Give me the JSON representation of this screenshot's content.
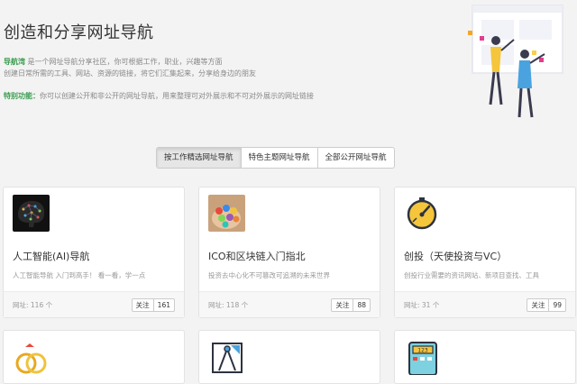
{
  "hero": {
    "title": "创造和分享网址导航",
    "brand": "导航湾",
    "intro_line1": "是一个网址导航分享社区，你可根据工作，职业，兴趣等方面",
    "intro_line2": "创建日常所需的工具、网站、资源的链接，将它们汇集起来，分享给身边的朋友",
    "feature_label": "特别功能：",
    "feature_text": "你可以创建公开和非公开的网址导航，用来整理可对外展示和不可对外展示的网址链接"
  },
  "tabs": [
    {
      "label": "按工作精选网址导航",
      "active": true
    },
    {
      "label": "特色主题网址导航",
      "active": false
    },
    {
      "label": "全部公开网址导航",
      "active": false
    }
  ],
  "cards": [
    {
      "title": "人工智能(AI)导航",
      "desc": "人工智能导航 入门到高手！ 看一看，学一点",
      "count": "网址: 116 个",
      "follow_label": "关注",
      "follow_count": "161"
    },
    {
      "title": "ICO和区块链入门指北",
      "desc": "投资去中心化不可篡改可追溯的未来世界",
      "count": "网址: 118 个",
      "follow_label": "关注",
      "follow_count": "88"
    },
    {
      "title": "创投（天使投资与VC）",
      "desc": "创投行业需要的资讯网站、新项目查找、工具",
      "count": "网址: 31 个",
      "follow_label": "关注",
      "follow_count": "99"
    }
  ],
  "colors": {
    "brand_green": "#3a9d4f",
    "page_bg": "#f3f3f3"
  }
}
